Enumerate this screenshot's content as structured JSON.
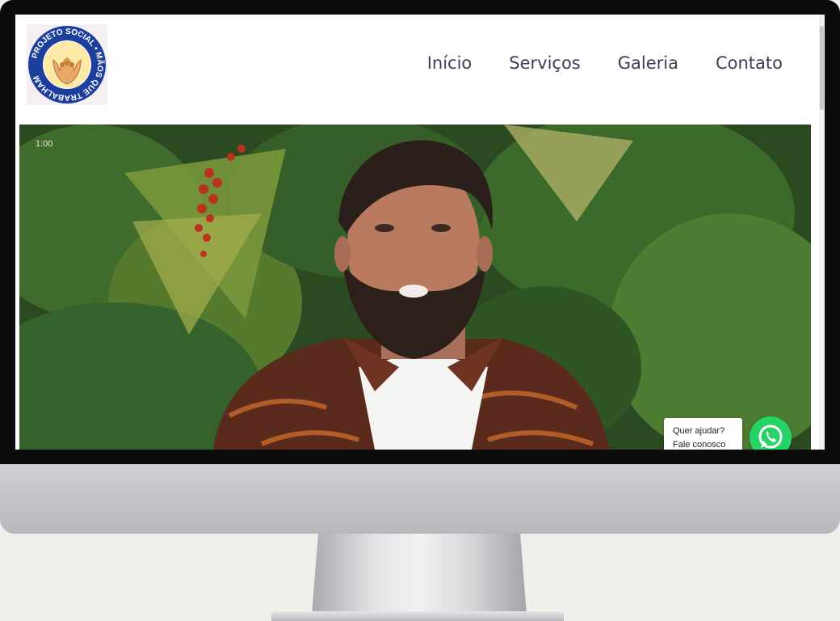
{
  "logo": {
    "text": "PROJETO SOCIAL • MÃOS QUE TRABALHAM"
  },
  "nav": {
    "items": [
      {
        "label": "Início"
      },
      {
        "label": "Serviços"
      },
      {
        "label": "Galeria"
      },
      {
        "label": "Contato"
      }
    ]
  },
  "video": {
    "timestamp": "1:00"
  },
  "whatsapp": {
    "line1": "Quer ajudar?",
    "line2": "Fale conosco",
    "icon": "whatsapp-icon",
    "color": "#25d366"
  },
  "colors": {
    "nav_text": "#3a3f55",
    "logo_ring": "#1c3f9e"
  }
}
